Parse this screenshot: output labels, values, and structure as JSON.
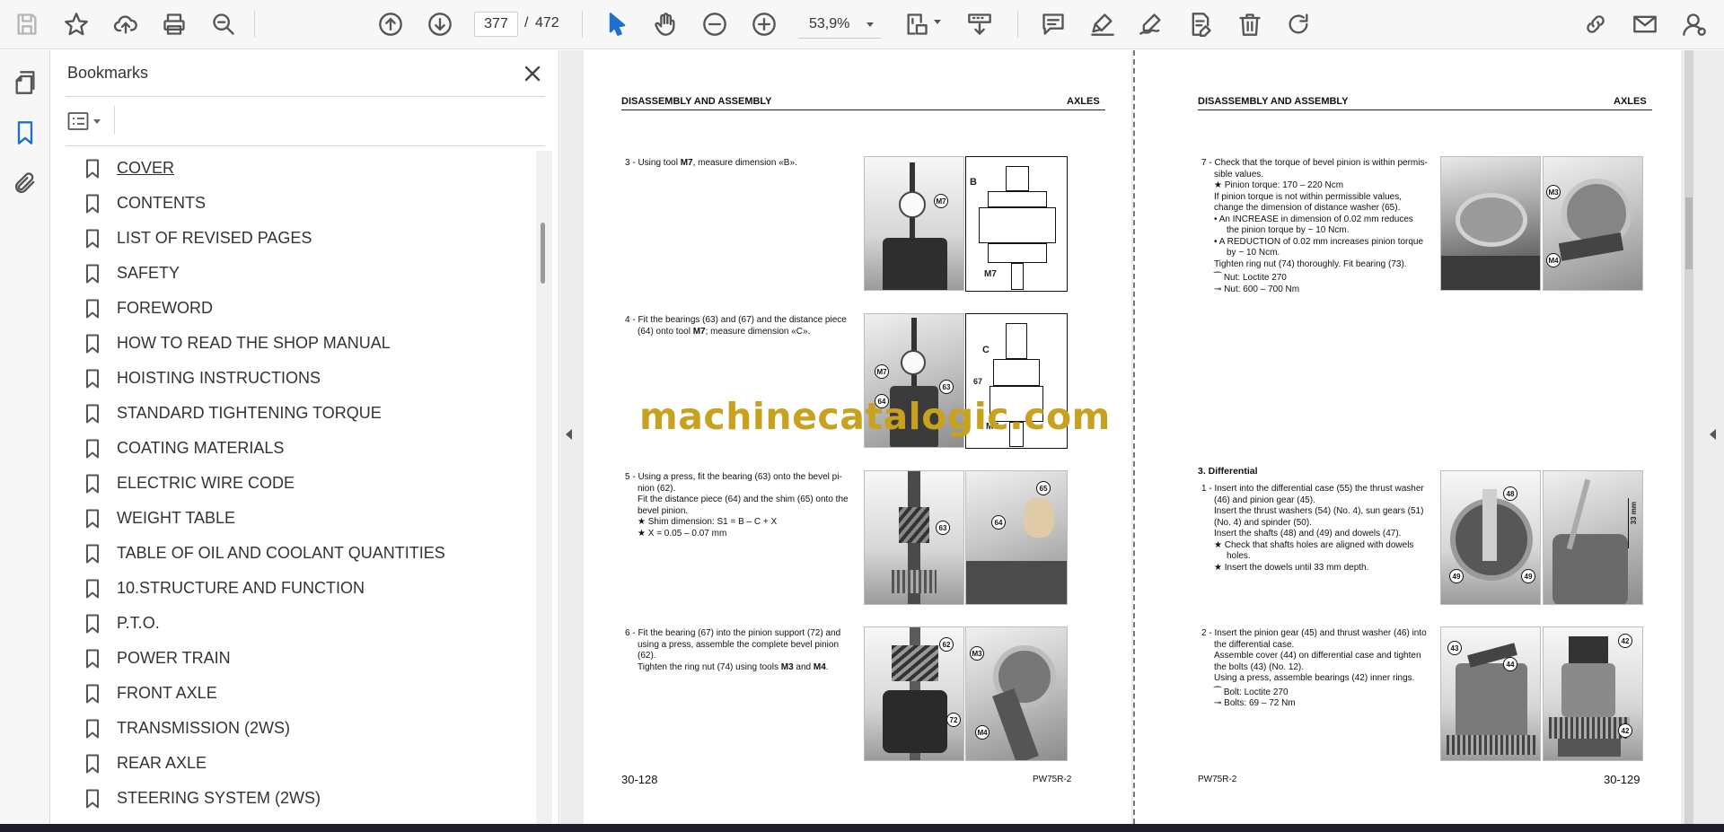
{
  "toolbar": {
    "icons": [
      "save-icon",
      "star-icon",
      "upload-icon",
      "print-icon",
      "zoom-search-icon",
      "previous-page-icon",
      "next-page-icon",
      "select-cursor-icon",
      "hand-tool-icon",
      "zoom-out-icon",
      "zoom-in-icon",
      "fit-page-icon",
      "scroll-mode-icon",
      "comment-icon",
      "highlight-icon",
      "sign-icon",
      "fill-sign-icon",
      "delete-icon",
      "rotate-icon",
      "share-link-icon",
      "email-icon",
      "account-icon"
    ],
    "page_current": "377",
    "page_separator": "/",
    "page_total": "472",
    "zoom": "53,9%"
  },
  "left_rail": {
    "icons": [
      "pages-thumbnail-icon",
      "bookmark-icon",
      "attachment-icon"
    ],
    "active": "bookmark-icon"
  },
  "bookmarks": {
    "title": "Bookmarks",
    "items": [
      "COVER",
      "CONTENTS",
      "LIST OF REVISED PAGES",
      "SAFETY",
      "FOREWORD",
      "HOW TO READ THE SHOP MANUAL",
      "HOISTING INSTRUCTIONS",
      "STANDARD TIGHTENING TORQUE",
      "COATING MATERIALS",
      "ELECTRIC WIRE CODE",
      "WEIGHT TABLE",
      "TABLE OF OIL AND COOLANT QUANTITIES",
      "10.STRUCTURE AND FUNCTION",
      "P.T.O.",
      "POWER TRAIN",
      "FRONT AXLE",
      "TRANSMISSION (2WS)",
      "REAR AXLE",
      "STEERING SYSTEM (2WS)"
    ]
  },
  "document": {
    "left_page": {
      "header_left": "DISASSEMBLY AND ASSEMBLY",
      "header_right": "AXLES",
      "steps": {
        "s3_pre": "3 - Using tool ",
        "s3_tool": "M7",
        "s3_post": ", measure dimension «B».",
        "s4_a": "4 - Fit the bearings (63) and (67) and the distance piece",
        "s4_b_pre": "(64) onto tool ",
        "s4_b_tool": "M7",
        "s4_b_post": "; measure dimension «C».",
        "s5_a": "5 - Using a press, fit the bearing (63) onto the bevel pi-",
        "s5_b": "nion (62).",
        "s5_c": "Fit the distance piece (64) and the shim (65) onto the",
        "s5_d": "bevel pinion.",
        "s5_e": "★   Shim dimension: S1 = B – C + X",
        "s5_f": "★   X = 0.05 – 0.07 mm",
        "s6_a": "6 - Fit the bearing (67) into the pinion support (72) and",
        "s6_b": "using a press, assemble the complete bevel pinion",
        "s6_c": "(62).",
        "s6_d_pre": "Tighten the ring nut (74) using tools ",
        "s6_d_t1": "M3",
        "s6_d_mid": " and ",
        "s6_d_t2": "M4",
        "s6_d_post": "."
      },
      "callouts": [
        "M7",
        "B",
        "M7",
        "M7",
        "63",
        "64",
        "C",
        "67",
        "M7",
        "65",
        "64",
        "63",
        "62",
        "72",
        "M3",
        "M4"
      ],
      "footer_number": "30-128",
      "footer_model": "PW75R-2"
    },
    "right_page": {
      "header_left": "DISASSEMBLY AND ASSEMBLY",
      "header_right": "AXLES",
      "steps": {
        "s7_a": "7 - Check that the torque of bevel pinion is within permis-",
        "s7_b": "sible values.",
        "s7_c": "★   Pinion torque: 170 – 220 Ncm",
        "s7_d": "If pinion torque is not within permissible values,",
        "s7_e": "change the dimension of distance washer (65).",
        "s7_f": "•   An INCREASE in dimension of 0.02 mm reduces",
        "s7_g": "the pinion torque by ~ 10 Ncm.",
        "s7_h": "•   A REDUCTION of 0.02 mm increases pinion torque",
        "s7_i": "by ~ 10 Ncm.",
        "s7_j": "Tighten ring nut (74) thoroughly. Fit bearing (73).",
        "s7_k": "Nut: Loctite 270",
        "s7_l": "Nut: 600 – 700 Nm",
        "section": "3. Differential",
        "d1_a": "1 - Insert into the differential case (55) the thrust washer",
        "d1_b": "(46) and pinion gear (45).",
        "d1_c": "Insert the thrust washers (54) (No. 4), sun gears (51)",
        "d1_d": "(No. 4) and spinder (50).",
        "d1_e": "Insert the shafts (48) and (49) and dowels (47).",
        "d1_f": "★   Check that shafts holes are aligned with dowels",
        "d1_g": "holes.",
        "d1_h": "★   Insert the dowels until 33 mm depth.",
        "d2_a": "2 - Insert the pinion gear (45) and thrust washer (46) into",
        "d2_b": "the differential case.",
        "d2_c": "Assemble cover (44) on differential case and tighten",
        "d2_d": "the bolts (43) (No. 12).",
        "d2_e": "Using a press, assemble bearings (42) inner rings.",
        "d2_f": "Bolt: Loctite 270",
        "d2_g": "Bolts: 69 – 72 Nm"
      },
      "callouts": [
        "M3",
        "M4",
        "48",
        "49",
        "49",
        "33 mm",
        "43",
        "44",
        "42",
        "42"
      ],
      "footer_number": "30-129",
      "footer_model": "PW75R-2"
    },
    "watermark": "machinecatalogic.com"
  }
}
